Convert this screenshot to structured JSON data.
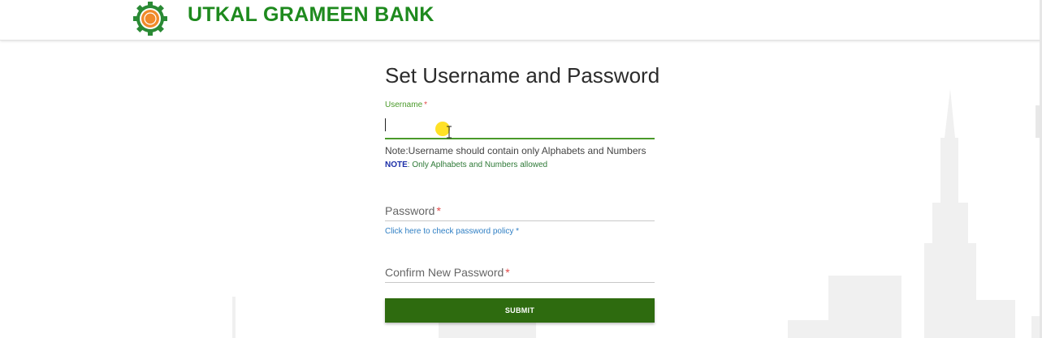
{
  "header": {
    "bank_name": "UTKAL GRAMEEN BANK",
    "logo_icon": "bank-gear-logo",
    "brand_color": "#1e8a1e"
  },
  "form": {
    "title": "Set Username and Password",
    "username": {
      "label": "Username",
      "required_mark": "*",
      "value": "",
      "note": "Note:Username should contain only Alphabets and Numbers",
      "note2_prefix": "NOTE",
      "note2_text": ": Only Aplhabets and Numbers allowed"
    },
    "password": {
      "label": "Password",
      "required_mark": "*",
      "policy_link": "Click here to check password policy *"
    },
    "confirm_password": {
      "label": "Confirm New Password",
      "required_mark": "*"
    },
    "submit_label": "SUBMIT"
  },
  "colors": {
    "accent_green": "#4a9a2a",
    "button_green": "#2e6b0f",
    "required_red": "#e34a4a",
    "link_blue": "#2f7fc4",
    "note_blue": "#1c2fa8"
  }
}
